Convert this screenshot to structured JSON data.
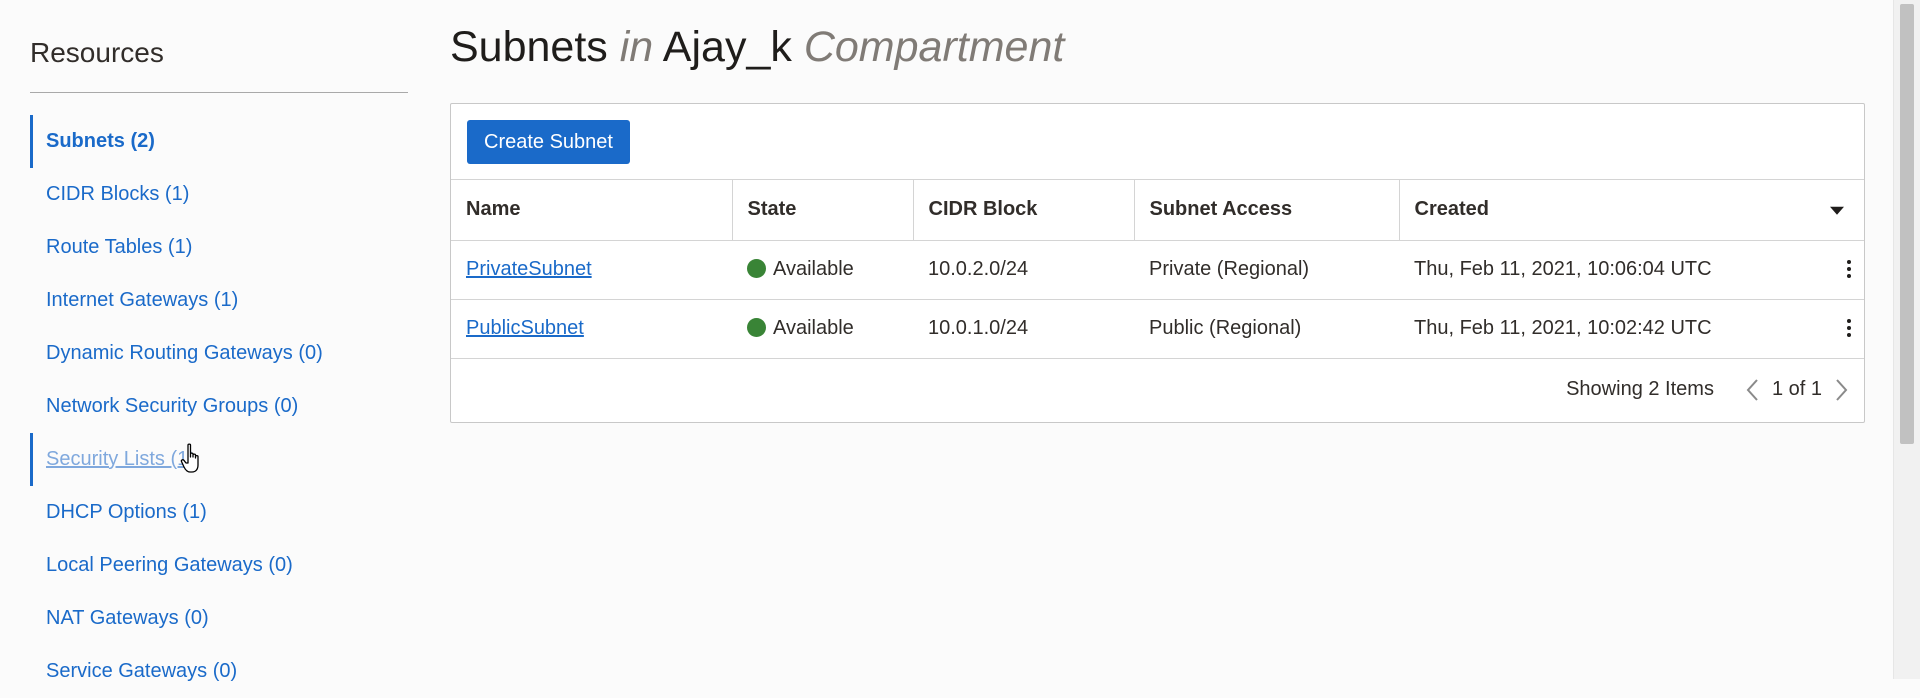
{
  "sidebar": {
    "title": "Resources",
    "items": [
      {
        "label": "Subnets (2)"
      },
      {
        "label": "CIDR Blocks (1)"
      },
      {
        "label": "Route Tables (1)"
      },
      {
        "label": "Internet Gateways (1)"
      },
      {
        "label": "Dynamic Routing Gateways (0)"
      },
      {
        "label": "Network Security Groups (0)"
      },
      {
        "label": "Security Lists (1)"
      },
      {
        "label": "DHCP Options (1)"
      },
      {
        "label": "Local Peering Gateways (0)"
      },
      {
        "label": "NAT Gateways (0)"
      },
      {
        "label": "Service Gateways (0)"
      }
    ],
    "active_index": 0,
    "hover_index": 6
  },
  "header": {
    "title_main": "Subnets",
    "title_in": "in",
    "compartment_name": "Ajay_k",
    "compartment_word": "Compartment"
  },
  "toolbar": {
    "create_label": "Create Subnet"
  },
  "table": {
    "columns": [
      "Name",
      "State",
      "CIDR Block",
      "Subnet Access",
      "Created"
    ],
    "rows": [
      {
        "name": "PrivateSubnet",
        "state": "Available",
        "cidr": "10.0.2.0/24",
        "access": "Private (Regional)",
        "created": "Thu, Feb 11, 2021, 10:06:04 UTC"
      },
      {
        "name": "PublicSubnet",
        "state": "Available",
        "cidr": "10.0.1.0/24",
        "access": "Public (Regional)",
        "created": "Thu, Feb 11, 2021, 10:02:42 UTC"
      }
    ]
  },
  "pager": {
    "showing": "Showing 2 Items",
    "page": "1 of 1"
  },
  "colors": {
    "accent": "#1a6ac9",
    "status_available": "#398436"
  },
  "icons": {
    "sort": "chevron-down-icon",
    "row_actions": "kebab-menu-icon",
    "prev": "chevron-left-icon",
    "next": "chevron-right-icon",
    "cursor": "hand-cursor-icon"
  }
}
